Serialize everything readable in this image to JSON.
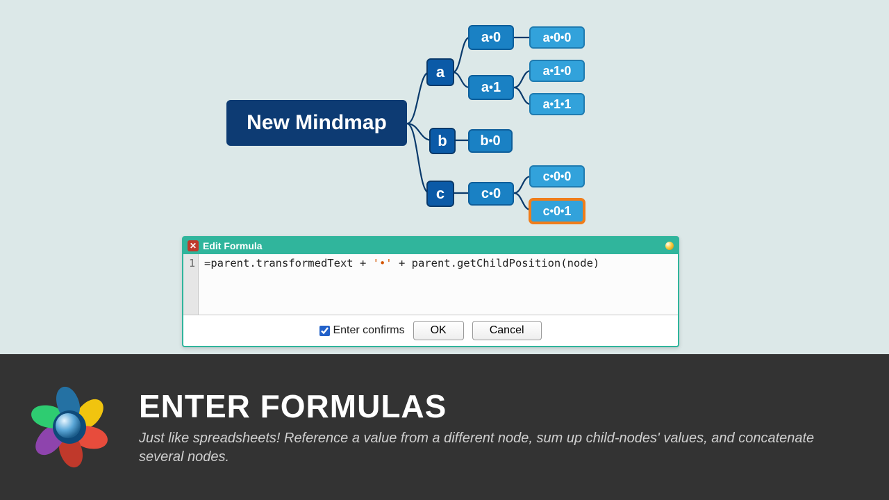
{
  "mindmap": {
    "root": "New Mindmap",
    "a": "a",
    "a0": "a•0",
    "a00": "a•0•0",
    "a1": "a•1",
    "a10": "a•1•0",
    "a11": "a•1•1",
    "b": "b",
    "b0": "b•0",
    "c": "c",
    "c0": "c•0",
    "c00": "c•0•0",
    "c01": "c•0•1"
  },
  "dialog": {
    "title": "Edit Formula",
    "line_number": "1",
    "formula_prefix": "=parent.transformedText + ",
    "formula_string": "'•'",
    "formula_suffix": " + parent.getChildPosition(node)",
    "confirm_label": "Enter confirms",
    "ok_label": "OK",
    "cancel_label": "Cancel"
  },
  "footer": {
    "heading": "ENTER FORMULAS",
    "body": "Just like spreadsheets! Reference a value from a different node, sum up child-nodes' values, and concatenate several nodes."
  },
  "chart_data": {
    "type": "tree",
    "title": "Mindmap hierarchy",
    "root": {
      "label": "New Mindmap",
      "children": [
        {
          "label": "a",
          "children": [
            {
              "label": "a•0",
              "children": [
                {
                  "label": "a•0•0"
                }
              ]
            },
            {
              "label": "a•1",
              "children": [
                {
                  "label": "a•1•0"
                },
                {
                  "label": "a•1•1"
                }
              ]
            }
          ]
        },
        {
          "label": "b",
          "children": [
            {
              "label": "b•0"
            }
          ]
        },
        {
          "label": "c",
          "children": [
            {
              "label": "c•0",
              "children": [
                {
                  "label": "c•0•0"
                },
                {
                  "label": "c•0•1",
                  "selected": true
                }
              ]
            }
          ]
        }
      ]
    }
  }
}
